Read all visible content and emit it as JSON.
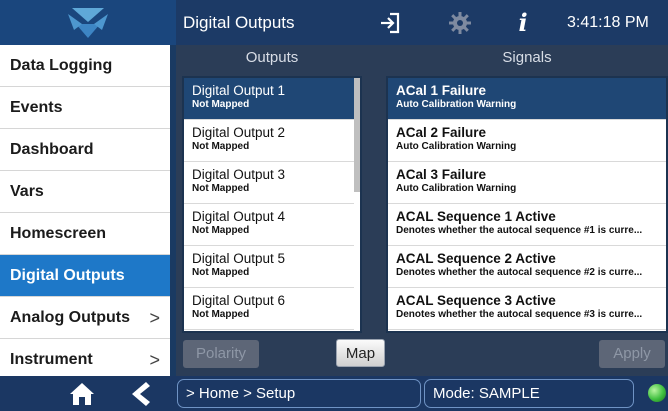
{
  "header": {
    "title": "Digital Outputs",
    "time": "3:41:18 PM",
    "icons": [
      "logo-icon",
      "sign-in-icon",
      "gear-icon",
      "info-icon"
    ]
  },
  "sidebar": {
    "items": [
      {
        "label": "Data Logging",
        "active": false,
        "arrow": ""
      },
      {
        "label": "Events",
        "active": false,
        "arrow": ""
      },
      {
        "label": "Dashboard",
        "active": false,
        "arrow": ""
      },
      {
        "label": "Vars",
        "active": false,
        "arrow": ""
      },
      {
        "label": "Homescreen",
        "active": false,
        "arrow": ""
      },
      {
        "label": "Digital Outputs",
        "active": true,
        "arrow": ""
      },
      {
        "label": "Analog Outputs",
        "active": false,
        "arrow": ">"
      },
      {
        "label": "Instrument",
        "active": false,
        "arrow": ">"
      }
    ]
  },
  "outputs": {
    "header": "Outputs",
    "items": [
      {
        "title": "Digital Output 1",
        "sub": "Not Mapped",
        "selected": true
      },
      {
        "title": "Digital Output 2",
        "sub": "Not Mapped",
        "selected": false
      },
      {
        "title": "Digital Output 3",
        "sub": "Not Mapped",
        "selected": false
      },
      {
        "title": "Digital Output 4",
        "sub": "Not Mapped",
        "selected": false
      },
      {
        "title": "Digital Output 5",
        "sub": "Not Mapped",
        "selected": false
      },
      {
        "title": "Digital Output 6",
        "sub": "Not Mapped",
        "selected": false
      }
    ]
  },
  "signals": {
    "header": "Signals",
    "items": [
      {
        "title": "ACal 1 Failure",
        "sub": "Auto Calibration Warning",
        "selected": true
      },
      {
        "title": "ACal 2 Failure",
        "sub": "Auto Calibration Warning",
        "selected": false
      },
      {
        "title": "ACal 3 Failure",
        "sub": "Auto Calibration Warning",
        "selected": false
      },
      {
        "title": "ACAL Sequence 1 Active",
        "sub": "Denotes whether the autocal sequence #1 is curre...",
        "selected": false
      },
      {
        "title": "ACAL Sequence 2 Active",
        "sub": "Denotes whether the autocal sequence #2 is curre...",
        "selected": false
      },
      {
        "title": "ACAL Sequence 3 Active",
        "sub": "Denotes whether the autocal sequence #3 is curre...",
        "selected": false
      }
    ]
  },
  "buttons": {
    "polarity": "Polarity",
    "map": "Map",
    "apply": "Apply"
  },
  "footer": {
    "breadcrumb": "> Home > Setup",
    "mode": "Mode: SAMPLE",
    "status_color": "#3fbf3f"
  },
  "colors": {
    "accent": "#1e78c8",
    "selected": "#1f4775",
    "topbar": "#1c3a66"
  }
}
